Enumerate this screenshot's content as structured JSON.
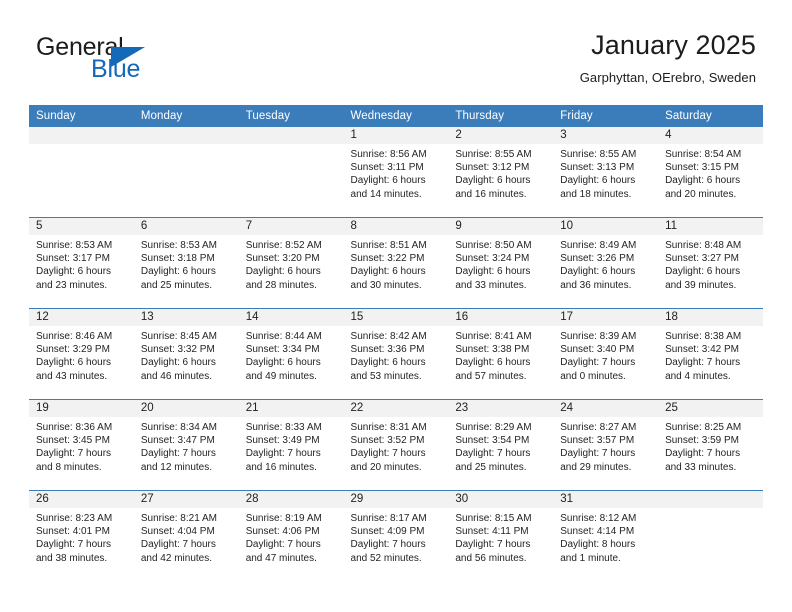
{
  "brand": {
    "name_part1": "General",
    "name_part2": "Blue",
    "logo_icon": "triangle-flag-icon"
  },
  "header": {
    "title": "January 2025",
    "location": "Garphyttan, OErebro, Sweden"
  },
  "colors": {
    "header_blue": "#3b7cba",
    "brand_blue": "#1569b9",
    "date_band_gray": "#f2f2f2",
    "text": "#222222"
  },
  "weekday_headers": [
    "Sunday",
    "Monday",
    "Tuesday",
    "Wednesday",
    "Thursday",
    "Friday",
    "Saturday"
  ],
  "labels": {
    "sunrise_prefix": "Sunrise:",
    "sunset_prefix": "Sunset:",
    "daylight_prefix": "Daylight:"
  },
  "weeks": [
    [
      {
        "empty": true
      },
      {
        "empty": true
      },
      {
        "empty": true
      },
      {
        "day": "1",
        "sunrise": "Sunrise: 8:56 AM",
        "sunset": "Sunset: 3:11 PM",
        "daylight": "Daylight: 6 hours and 14 minutes."
      },
      {
        "day": "2",
        "sunrise": "Sunrise: 8:55 AM",
        "sunset": "Sunset: 3:12 PM",
        "daylight": "Daylight: 6 hours and 16 minutes."
      },
      {
        "day": "3",
        "sunrise": "Sunrise: 8:55 AM",
        "sunset": "Sunset: 3:13 PM",
        "daylight": "Daylight: 6 hours and 18 minutes."
      },
      {
        "day": "4",
        "sunrise": "Sunrise: 8:54 AM",
        "sunset": "Sunset: 3:15 PM",
        "daylight": "Daylight: 6 hours and 20 minutes."
      }
    ],
    [
      {
        "day": "5",
        "sunrise": "Sunrise: 8:53 AM",
        "sunset": "Sunset: 3:17 PM",
        "daylight": "Daylight: 6 hours and 23 minutes."
      },
      {
        "day": "6",
        "sunrise": "Sunrise: 8:53 AM",
        "sunset": "Sunset: 3:18 PM",
        "daylight": "Daylight: 6 hours and 25 minutes."
      },
      {
        "day": "7",
        "sunrise": "Sunrise: 8:52 AM",
        "sunset": "Sunset: 3:20 PM",
        "daylight": "Daylight: 6 hours and 28 minutes."
      },
      {
        "day": "8",
        "sunrise": "Sunrise: 8:51 AM",
        "sunset": "Sunset: 3:22 PM",
        "daylight": "Daylight: 6 hours and 30 minutes."
      },
      {
        "day": "9",
        "sunrise": "Sunrise: 8:50 AM",
        "sunset": "Sunset: 3:24 PM",
        "daylight": "Daylight: 6 hours and 33 minutes."
      },
      {
        "day": "10",
        "sunrise": "Sunrise: 8:49 AM",
        "sunset": "Sunset: 3:26 PM",
        "daylight": "Daylight: 6 hours and 36 minutes."
      },
      {
        "day": "11",
        "sunrise": "Sunrise: 8:48 AM",
        "sunset": "Sunset: 3:27 PM",
        "daylight": "Daylight: 6 hours and 39 minutes."
      }
    ],
    [
      {
        "day": "12",
        "sunrise": "Sunrise: 8:46 AM",
        "sunset": "Sunset: 3:29 PM",
        "daylight": "Daylight: 6 hours and 43 minutes."
      },
      {
        "day": "13",
        "sunrise": "Sunrise: 8:45 AM",
        "sunset": "Sunset: 3:32 PM",
        "daylight": "Daylight: 6 hours and 46 minutes."
      },
      {
        "day": "14",
        "sunrise": "Sunrise: 8:44 AM",
        "sunset": "Sunset: 3:34 PM",
        "daylight": "Daylight: 6 hours and 49 minutes."
      },
      {
        "day": "15",
        "sunrise": "Sunrise: 8:42 AM",
        "sunset": "Sunset: 3:36 PM",
        "daylight": "Daylight: 6 hours and 53 minutes."
      },
      {
        "day": "16",
        "sunrise": "Sunrise: 8:41 AM",
        "sunset": "Sunset: 3:38 PM",
        "daylight": "Daylight: 6 hours and 57 minutes."
      },
      {
        "day": "17",
        "sunrise": "Sunrise: 8:39 AM",
        "sunset": "Sunset: 3:40 PM",
        "daylight": "Daylight: 7 hours and 0 minutes."
      },
      {
        "day": "18",
        "sunrise": "Sunrise: 8:38 AM",
        "sunset": "Sunset: 3:42 PM",
        "daylight": "Daylight: 7 hours and 4 minutes."
      }
    ],
    [
      {
        "day": "19",
        "sunrise": "Sunrise: 8:36 AM",
        "sunset": "Sunset: 3:45 PM",
        "daylight": "Daylight: 7 hours and 8 minutes."
      },
      {
        "day": "20",
        "sunrise": "Sunrise: 8:34 AM",
        "sunset": "Sunset: 3:47 PM",
        "daylight": "Daylight: 7 hours and 12 minutes."
      },
      {
        "day": "21",
        "sunrise": "Sunrise: 8:33 AM",
        "sunset": "Sunset: 3:49 PM",
        "daylight": "Daylight: 7 hours and 16 minutes."
      },
      {
        "day": "22",
        "sunrise": "Sunrise: 8:31 AM",
        "sunset": "Sunset: 3:52 PM",
        "daylight": "Daylight: 7 hours and 20 minutes."
      },
      {
        "day": "23",
        "sunrise": "Sunrise: 8:29 AM",
        "sunset": "Sunset: 3:54 PM",
        "daylight": "Daylight: 7 hours and 25 minutes."
      },
      {
        "day": "24",
        "sunrise": "Sunrise: 8:27 AM",
        "sunset": "Sunset: 3:57 PM",
        "daylight": "Daylight: 7 hours and 29 minutes."
      },
      {
        "day": "25",
        "sunrise": "Sunrise: 8:25 AM",
        "sunset": "Sunset: 3:59 PM",
        "daylight": "Daylight: 7 hours and 33 minutes."
      }
    ],
    [
      {
        "day": "26",
        "sunrise": "Sunrise: 8:23 AM",
        "sunset": "Sunset: 4:01 PM",
        "daylight": "Daylight: 7 hours and 38 minutes."
      },
      {
        "day": "27",
        "sunrise": "Sunrise: 8:21 AM",
        "sunset": "Sunset: 4:04 PM",
        "daylight": "Daylight: 7 hours and 42 minutes."
      },
      {
        "day": "28",
        "sunrise": "Sunrise: 8:19 AM",
        "sunset": "Sunset: 4:06 PM",
        "daylight": "Daylight: 7 hours and 47 minutes."
      },
      {
        "day": "29",
        "sunrise": "Sunrise: 8:17 AM",
        "sunset": "Sunset: 4:09 PM",
        "daylight": "Daylight: 7 hours and 52 minutes."
      },
      {
        "day": "30",
        "sunrise": "Sunrise: 8:15 AM",
        "sunset": "Sunset: 4:11 PM",
        "daylight": "Daylight: 7 hours and 56 minutes."
      },
      {
        "day": "31",
        "sunrise": "Sunrise: 8:12 AM",
        "sunset": "Sunset: 4:14 PM",
        "daylight": "Daylight: 8 hours and 1 minute."
      },
      {
        "empty": true
      }
    ]
  ]
}
